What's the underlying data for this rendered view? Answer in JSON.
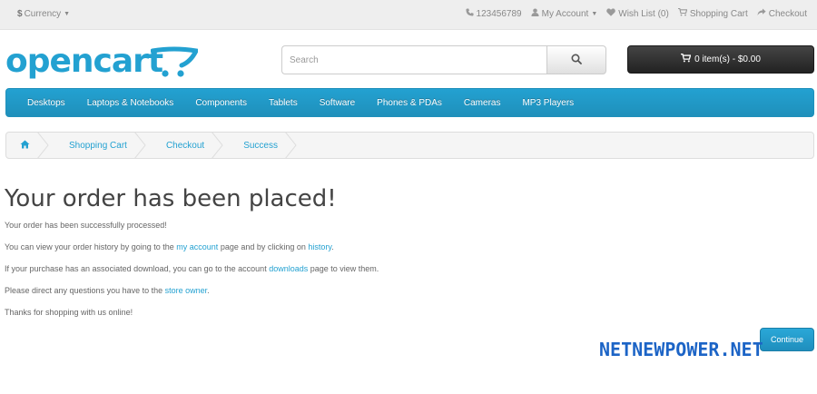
{
  "topbar": {
    "currency_symbol": "$",
    "currency_label": "Currency",
    "phone": "123456789",
    "my_account": "My Account",
    "wishlist": "Wish List (0)",
    "shopping_cart": "Shopping Cart",
    "checkout": "Checkout"
  },
  "header": {
    "logo_text": "opencart",
    "search_placeholder": "Search",
    "cart_label": "0 item(s) - $0.00"
  },
  "menu": {
    "items": [
      "Desktops",
      "Laptops & Notebooks",
      "Components",
      "Tablets",
      "Software",
      "Phones & PDAs",
      "Cameras",
      "MP3 Players"
    ]
  },
  "breadcrumb": {
    "items": [
      "Shopping Cart",
      "Checkout",
      "Success"
    ]
  },
  "content": {
    "title": "Your order has been placed!",
    "p1": "Your order has been successfully processed!",
    "p2_a": "You can view your order history by going to the ",
    "p2_link1": "my account",
    "p2_b": " page and by clicking on ",
    "p2_link2": "history",
    "p2_c": ".",
    "p3_a": "If your purchase has an associated download, you can go to the account ",
    "p3_link": "downloads",
    "p3_b": " page to view them.",
    "p4_a": "Please direct any questions you have to the ",
    "p4_link": "store owner",
    "p4_b": ".",
    "p5": "Thanks for shopping with us online!",
    "continue_label": "Continue"
  },
  "watermark": "NETNEWPOWER.NET",
  "colors": {
    "accent": "#23a1d1",
    "cart_button": "#333333",
    "watermark": "#1c64c6"
  },
  "icons": {
    "phone": "phone-icon",
    "account": "user-icon",
    "wishlist": "heart-icon",
    "cart": "cart-icon",
    "checkout": "share-icon",
    "search": "search-icon",
    "home": "home-icon"
  }
}
